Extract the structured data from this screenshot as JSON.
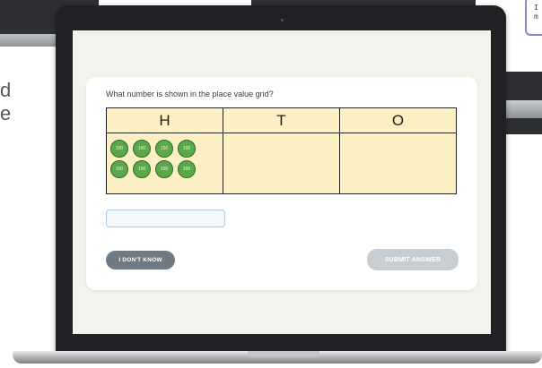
{
  "background": {
    "left_text_lines": [
      "d",
      "e"
    ],
    "card_text_lines": [
      "I c",
      "m"
    ]
  },
  "question": {
    "prompt": "What number is shown in the place value grid?",
    "grid": {
      "headers": [
        "H",
        "T",
        "O"
      ],
      "hundreds_counter_label": "100",
      "hundreds_count": 8,
      "tens_count": 0,
      "ones_count": 0
    },
    "answer": {
      "value": "",
      "placeholder": ""
    },
    "buttons": {
      "dont_know": "I DON'T KNOW",
      "submit": "SUBMIT ANSWER"
    }
  },
  "colors": {
    "grid_fill": "#fcefc4",
    "counter_green": "#5aa847",
    "dont_know_button": "#6f7b84",
    "submit_button_disabled": "#c8cdd1",
    "input_border": "#a9cbe6"
  }
}
